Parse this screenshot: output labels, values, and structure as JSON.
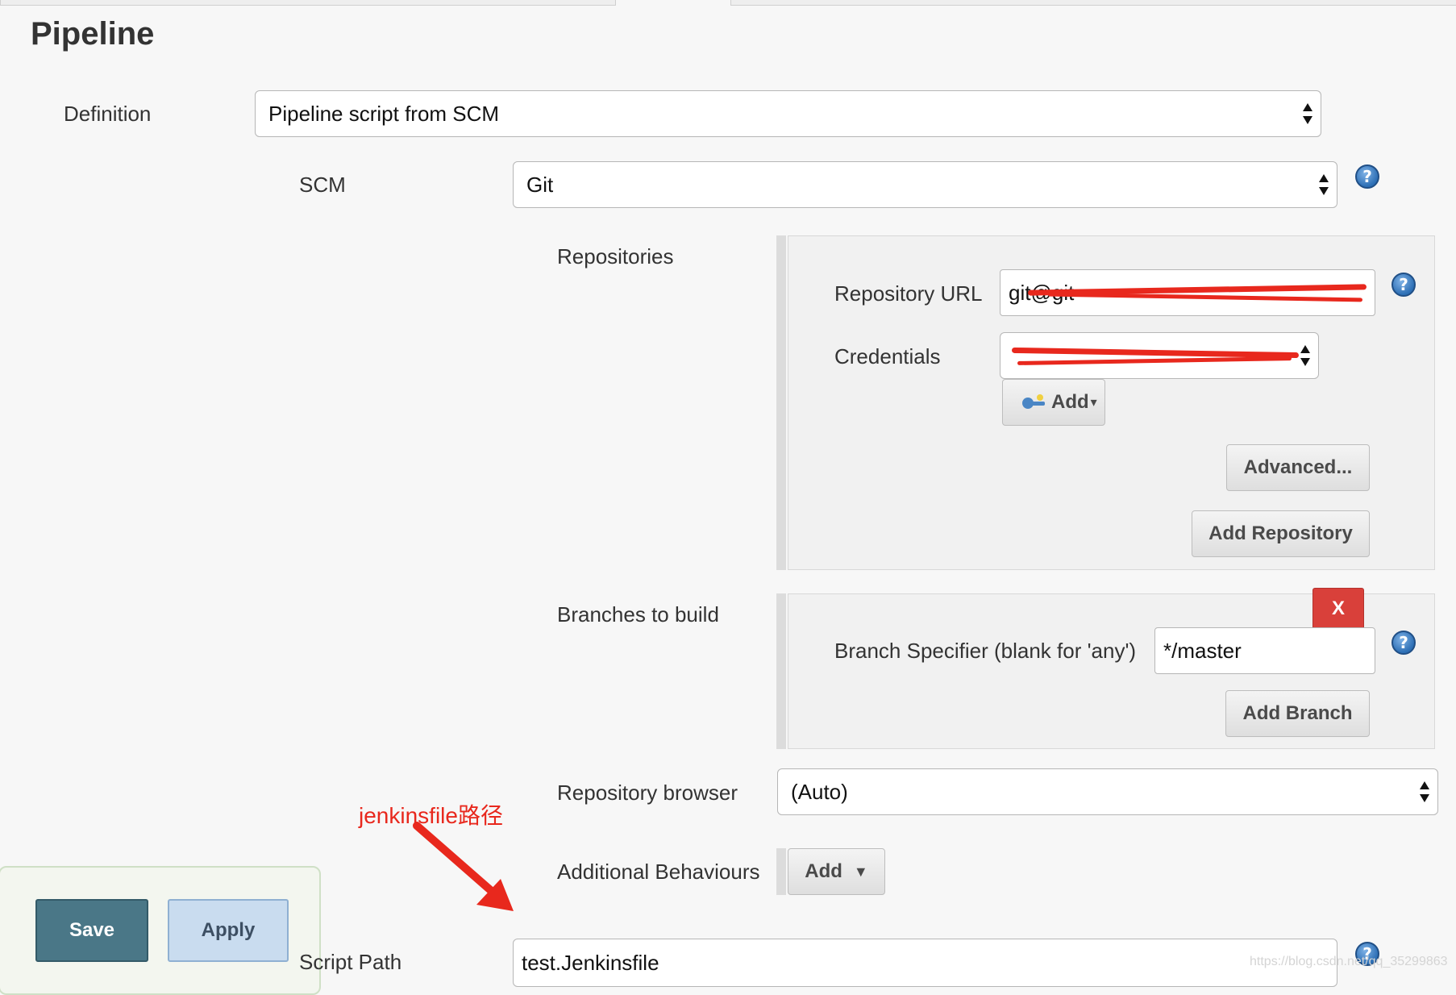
{
  "section": {
    "title": "Pipeline"
  },
  "definition": {
    "label": "Definition",
    "value": "Pipeline script from SCM"
  },
  "scm": {
    "label": "SCM",
    "value": "Git"
  },
  "repositories": {
    "label": "Repositories",
    "url_label": "Repository URL",
    "url_value": "git@git",
    "credentials_label": "Credentials",
    "add_label": "Add",
    "advanced_label": "Advanced...",
    "add_repository_label": "Add Repository"
  },
  "branches": {
    "label": "Branches to build",
    "delete_label": "X",
    "specifier_label": "Branch Specifier (blank for 'any')",
    "specifier_value": "*/master",
    "add_branch_label": "Add Branch"
  },
  "repository_browser": {
    "label": "Repository browser",
    "value": "(Auto)"
  },
  "additional_behaviours": {
    "label": "Additional Behaviours",
    "add_label": "Add"
  },
  "script_path": {
    "label": "Script Path",
    "value": "test.Jenkinsfile"
  },
  "annotation": {
    "text": "jenkinsfile路径",
    "color": "#e8281d"
  },
  "actions": {
    "save_label": "Save",
    "apply_label": "Apply"
  },
  "help_icon_text": "?",
  "watermark": "https://blog.csdn.net/qq_35299863",
  "colors": {
    "save_button": "#4a7787",
    "apply_button": "#c9dcef",
    "delete_button": "#d9403a",
    "help_icon": "#2d6fb5"
  }
}
